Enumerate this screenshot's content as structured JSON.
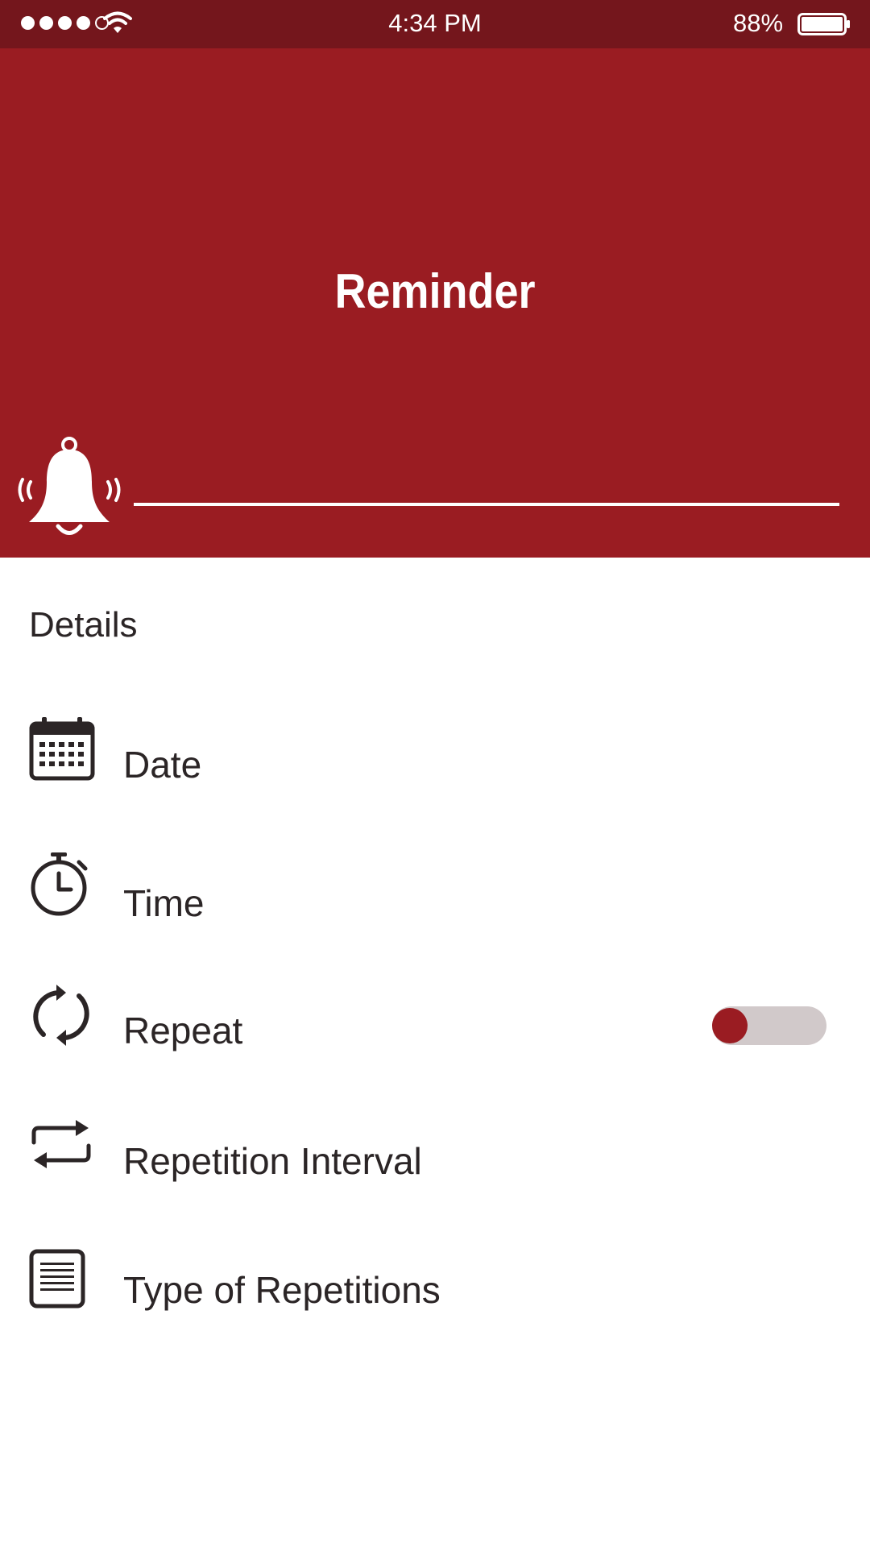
{
  "status_bar": {
    "time": "4:34 PM",
    "battery": "88%",
    "battery_level": 0.88,
    "signal_bars": 4,
    "signal_total": 5
  },
  "header": {
    "title": "Reminder",
    "icon": "bell-ringing-icon",
    "background_color": "#9a1c22"
  },
  "details": {
    "section_title": "Details",
    "items": [
      {
        "label": "Date",
        "icon": "calendar-icon"
      },
      {
        "label": "Time",
        "icon": "stopwatch-icon"
      },
      {
        "label": "Repeat",
        "icon": "refresh-icon",
        "toggle": false
      },
      {
        "label": "Repetition Interval",
        "icon": "swap-arrows-icon"
      },
      {
        "label": "Type of Repetitions",
        "icon": "document-list-icon"
      }
    ]
  },
  "colors": {
    "accent": "#9a1c22",
    "status_bar": "#74161c",
    "toggle_track": "#d1c9ca",
    "text": "#2b2526"
  }
}
